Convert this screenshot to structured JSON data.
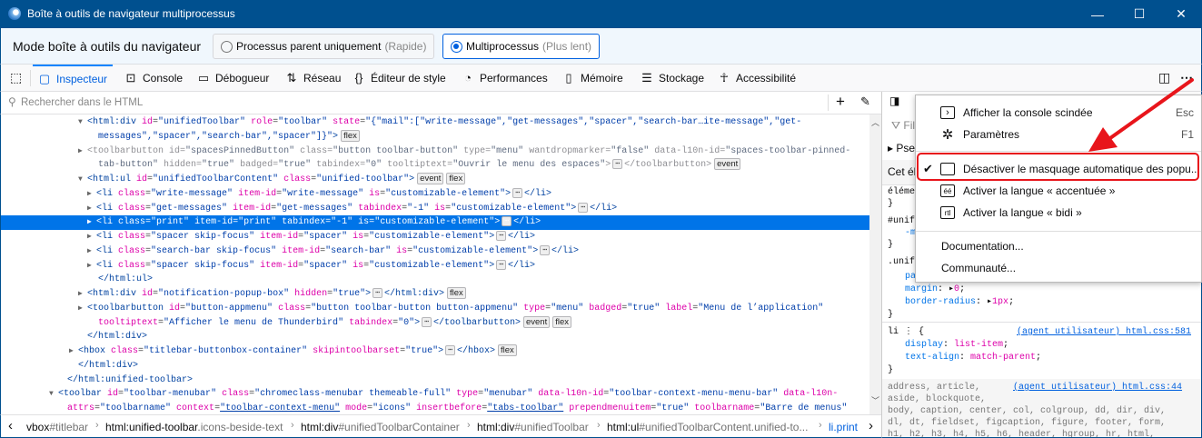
{
  "window": {
    "title": "Boîte à outils de navigateur multiprocessus",
    "minimize": "—",
    "maximize": "☐",
    "close": "✕"
  },
  "mode": {
    "label": "Mode boîte à outils du navigateur",
    "options": [
      {
        "label": "Processus parent uniquement",
        "hint": "(Rapide)",
        "selected": false
      },
      {
        "label": "Multiprocessus",
        "hint": "(Plus lent)",
        "selected": true
      }
    ]
  },
  "tabs": [
    {
      "label": "Inspecteur",
      "icon": "inspector-icon"
    },
    {
      "label": "Console",
      "icon": "console-icon"
    },
    {
      "label": "Débogueur",
      "icon": "debugger-icon"
    },
    {
      "label": "Réseau",
      "icon": "network-icon"
    },
    {
      "label": "Éditeur de style",
      "icon": "style-editor-icon"
    },
    {
      "label": "Performances",
      "icon": "performance-icon"
    },
    {
      "label": "Mémoire",
      "icon": "memory-icon"
    },
    {
      "label": "Stockage",
      "icon": "storage-icon"
    },
    {
      "label": "Accessibilité",
      "icon": "accessibility-icon"
    }
  ],
  "search": {
    "placeholder": "Rechercher dans le HTML"
  },
  "markup": [
    {
      "ind": 95,
      "arrow": "▼",
      "segs": [
        [
          "t",
          "<html:div "
        ],
        [
          "a",
          "id"
        ],
        [
          "p",
          "="
        ],
        [
          "v",
          "\"unifiedToolbar\" "
        ],
        [
          "a",
          "role"
        ],
        [
          "p",
          "="
        ],
        [
          "v",
          "\"toolbar\" "
        ],
        [
          "a",
          "state"
        ],
        [
          "p",
          "="
        ],
        [
          "v",
          "\"{\"mail\":[\"write-message\",\"get-messages\",\"spacer\",\"search-bar…ite-message\",\"get-"
        ]
      ]
    },
    {
      "ind": 107,
      "segs": [
        [
          "v",
          "messages\",\"spacer\",\"search-bar\",\"spacer\"]}\""
        ],
        [
          "t",
          ">"
        ],
        [
          "b",
          "flex"
        ]
      ]
    },
    {
      "ind": 95,
      "arrow": "▶",
      "dim": true,
      "segs": [
        [
          "t",
          "<toolbarbutton "
        ],
        [
          "a",
          "id"
        ],
        [
          "p",
          "="
        ],
        [
          "v",
          "\"spacesPinnedButton\" "
        ],
        [
          "a",
          "class"
        ],
        [
          "p",
          "="
        ],
        [
          "v",
          "\"button toolbar-button\" "
        ],
        [
          "a",
          "type"
        ],
        [
          "p",
          "="
        ],
        [
          "v",
          "\"menu\" "
        ],
        [
          "a",
          "wantdropmarker"
        ],
        [
          "p",
          "="
        ],
        [
          "v",
          "\"false\" "
        ],
        [
          "a",
          "data-l10n-id"
        ],
        [
          "p",
          "="
        ],
        [
          "v",
          "\"spaces-toolbar-pinned-"
        ]
      ]
    },
    {
      "ind": 107,
      "dim": true,
      "segs": [
        [
          "v",
          "tab-button\" "
        ],
        [
          "a",
          "hidden"
        ],
        [
          "p",
          "="
        ],
        [
          "v",
          "\"true\" "
        ],
        [
          "a",
          "badged"
        ],
        [
          "p",
          "="
        ],
        [
          "v",
          "\"true\" "
        ],
        [
          "a",
          "tabindex"
        ],
        [
          "p",
          "="
        ],
        [
          "v",
          "\"0\" "
        ],
        [
          "a",
          "tooltiptext"
        ],
        [
          "p",
          "="
        ],
        [
          "v",
          "\"Ouvrir le menu des espaces\""
        ],
        [
          "t",
          ">"
        ],
        [
          "e",
          "⋯"
        ],
        [
          "t",
          "</toolbarbutton>"
        ],
        [
          "b",
          "event"
        ]
      ]
    },
    {
      "ind": 95,
      "arrow": "▼",
      "segs": [
        [
          "t",
          "<html:ul "
        ],
        [
          "a",
          "id"
        ],
        [
          "p",
          "="
        ],
        [
          "v",
          "\"unifiedToolbarContent\" "
        ],
        [
          "a",
          "class"
        ],
        [
          "p",
          "="
        ],
        [
          "v",
          "\"unified-toolbar\""
        ],
        [
          "t",
          ">"
        ],
        [
          "b",
          "event"
        ],
        [
          "b",
          "flex"
        ]
      ]
    },
    {
      "ind": 105,
      "arrow": "▶",
      "segs": [
        [
          "t",
          "<li "
        ],
        [
          "a",
          "class"
        ],
        [
          "p",
          "="
        ],
        [
          "v",
          "\"write-message\" "
        ],
        [
          "a",
          "item-id"
        ],
        [
          "p",
          "="
        ],
        [
          "v",
          "\"write-message\" "
        ],
        [
          "a",
          "is"
        ],
        [
          "p",
          "="
        ],
        [
          "v",
          "\"customizable-element\""
        ],
        [
          "t",
          ">"
        ],
        [
          "e",
          "⋯"
        ],
        [
          "t",
          "</li>"
        ]
      ]
    },
    {
      "ind": 105,
      "arrow": "▶",
      "segs": [
        [
          "t",
          "<li "
        ],
        [
          "a",
          "class"
        ],
        [
          "p",
          "="
        ],
        [
          "v",
          "\"get-messages\" "
        ],
        [
          "a",
          "item-id"
        ],
        [
          "p",
          "="
        ],
        [
          "v",
          "\"get-messages\" "
        ],
        [
          "a",
          "tabindex"
        ],
        [
          "p",
          "="
        ],
        [
          "v",
          "\"-1\" "
        ],
        [
          "a",
          "is"
        ],
        [
          "p",
          "="
        ],
        [
          "v",
          "\"customizable-element\""
        ],
        [
          "t",
          ">"
        ],
        [
          "e",
          "⋯"
        ],
        [
          "t",
          "</li>"
        ]
      ]
    },
    {
      "ind": 105,
      "arrow": "▶",
      "sel": true,
      "segs": [
        [
          "t",
          "<li "
        ],
        [
          "a",
          "class"
        ],
        [
          "p",
          "="
        ],
        [
          "v",
          "\"print\" "
        ],
        [
          "a",
          "item-id"
        ],
        [
          "p",
          "="
        ],
        [
          "v",
          "\"print\" "
        ],
        [
          "a",
          "tabindex"
        ],
        [
          "p",
          "="
        ],
        [
          "v",
          "\"-1\" "
        ],
        [
          "a",
          "is"
        ],
        [
          "p",
          "="
        ],
        [
          "v",
          "\"customizable-element\""
        ],
        [
          "t",
          ">"
        ],
        [
          "e",
          "⋯"
        ],
        [
          "t",
          "</li>"
        ]
      ]
    },
    {
      "ind": 105,
      "arrow": "▶",
      "segs": [
        [
          "t",
          "<li "
        ],
        [
          "a",
          "class"
        ],
        [
          "p",
          "="
        ],
        [
          "v",
          "\"spacer skip-focus\" "
        ],
        [
          "a",
          "item-id"
        ],
        [
          "p",
          "="
        ],
        [
          "v",
          "\"spacer\" "
        ],
        [
          "a",
          "is"
        ],
        [
          "p",
          "="
        ],
        [
          "v",
          "\"customizable-element\""
        ],
        [
          "t",
          ">"
        ],
        [
          "e",
          "⋯"
        ],
        [
          "t",
          "</li>"
        ]
      ]
    },
    {
      "ind": 105,
      "arrow": "▶",
      "segs": [
        [
          "t",
          "<li "
        ],
        [
          "a",
          "class"
        ],
        [
          "p",
          "="
        ],
        [
          "v",
          "\"search-bar skip-focus\" "
        ],
        [
          "a",
          "item-id"
        ],
        [
          "p",
          "="
        ],
        [
          "v",
          "\"search-bar\" "
        ],
        [
          "a",
          "is"
        ],
        [
          "p",
          "="
        ],
        [
          "v",
          "\"customizable-element\""
        ],
        [
          "t",
          ">"
        ],
        [
          "e",
          "⋯"
        ],
        [
          "t",
          "</li>"
        ]
      ]
    },
    {
      "ind": 105,
      "arrow": "▶",
      "segs": [
        [
          "t",
          "<li "
        ],
        [
          "a",
          "class"
        ],
        [
          "p",
          "="
        ],
        [
          "v",
          "\"spacer skip-focus\" "
        ],
        [
          "a",
          "item-id"
        ],
        [
          "p",
          "="
        ],
        [
          "v",
          "\"spacer\" "
        ],
        [
          "a",
          "is"
        ],
        [
          "p",
          "="
        ],
        [
          "v",
          "\"customizable-element\""
        ],
        [
          "t",
          ">"
        ],
        [
          "e",
          "⋯"
        ],
        [
          "t",
          "</li>"
        ]
      ]
    },
    {
      "ind": 107,
      "segs": [
        [
          "t",
          "</html:ul>"
        ]
      ]
    },
    {
      "ind": 95,
      "arrow": "▶",
      "segs": [
        [
          "t",
          "<html:div "
        ],
        [
          "a",
          "id"
        ],
        [
          "p",
          "="
        ],
        [
          "v",
          "\"notification-popup-box\" "
        ],
        [
          "a",
          "hidden"
        ],
        [
          "p",
          "="
        ],
        [
          "v",
          "\"true\""
        ],
        [
          "t",
          ">"
        ],
        [
          "e",
          "⋯"
        ],
        [
          "t",
          "</html:div>"
        ],
        [
          "b",
          "flex"
        ]
      ]
    },
    {
      "ind": 95,
      "arrow": "▶",
      "segs": [
        [
          "t",
          "<toolbarbutton "
        ],
        [
          "a",
          "id"
        ],
        [
          "p",
          "="
        ],
        [
          "v",
          "\"button-appmenu\" "
        ],
        [
          "a",
          "class"
        ],
        [
          "p",
          "="
        ],
        [
          "v",
          "\"button toolbar-button button-appmenu\" "
        ],
        [
          "a",
          "type"
        ],
        [
          "p",
          "="
        ],
        [
          "v",
          "\"menu\" "
        ],
        [
          "a",
          "badged"
        ],
        [
          "p",
          "="
        ],
        [
          "v",
          "\"true\" "
        ],
        [
          "a",
          "label"
        ],
        [
          "p",
          "="
        ],
        [
          "v",
          "\"Menu de l’application\""
        ]
      ]
    },
    {
      "ind": 107,
      "segs": [
        [
          "a",
          "tooltiptext"
        ],
        [
          "p",
          "="
        ],
        [
          "v",
          "\"Afficher le menu de Thunderbird\" "
        ],
        [
          "a",
          "tabindex"
        ],
        [
          "p",
          "="
        ],
        [
          "v",
          "\"0\""
        ],
        [
          "t",
          ">"
        ],
        [
          "e",
          "⋯"
        ],
        [
          "t",
          "</toolbarbutton>"
        ],
        [
          "b",
          "event"
        ],
        [
          "b",
          "flex"
        ]
      ]
    },
    {
      "ind": 95,
      "segs": [
        [
          "t",
          "</html:div>"
        ]
      ]
    },
    {
      "ind": 85,
      "arrow": "▶",
      "segs": [
        [
          "t",
          "<hbox "
        ],
        [
          "a",
          "class"
        ],
        [
          "p",
          "="
        ],
        [
          "v",
          "\"titlebar-buttonbox-container\" "
        ],
        [
          "a",
          "skipintoolbarset"
        ],
        [
          "p",
          "="
        ],
        [
          "v",
          "\"true\""
        ],
        [
          "t",
          ">"
        ],
        [
          "e",
          "⋯"
        ],
        [
          "t",
          "</hbox>"
        ],
        [
          "b",
          "flex"
        ]
      ]
    },
    {
      "ind": 85,
      "segs": [
        [
          "t",
          "</html:div>"
        ]
      ]
    },
    {
      "ind": 73,
      "segs": [
        [
          "t",
          "</html:unified-toolbar>"
        ]
      ]
    },
    {
      "ind": 63,
      "arrow": "▼",
      "segs": [
        [
          "t",
          "<toolbar "
        ],
        [
          "a",
          "id"
        ],
        [
          "p",
          "="
        ],
        [
          "v",
          "\"toolbar-menubar\" "
        ],
        [
          "a",
          "class"
        ],
        [
          "p",
          "="
        ],
        [
          "v",
          "\"chromeclass-menubar themeable-full\" "
        ],
        [
          "a",
          "type"
        ],
        [
          "p",
          "="
        ],
        [
          "v",
          "\"menubar\" "
        ],
        [
          "a",
          "data-l10n-id"
        ],
        [
          "p",
          "="
        ],
        [
          "v",
          "\"toolbar-context-menu-menu-bar\" "
        ],
        [
          "a",
          "data-l10n-"
        ]
      ]
    },
    {
      "ind": 73,
      "segs": [
        [
          "a",
          "attrs"
        ],
        [
          "p",
          "="
        ],
        [
          "v",
          "\"toolbarname\" "
        ],
        [
          "a",
          "context"
        ],
        [
          "p",
          "="
        ],
        [
          "u",
          "\"toolbar-context-menu\""
        ],
        [
          "p",
          " "
        ],
        [
          "a",
          "mode"
        ],
        [
          "p",
          "="
        ],
        [
          "v",
          "\"icons\" "
        ],
        [
          "a",
          "insertbefore"
        ],
        [
          "p",
          "="
        ],
        [
          "u",
          "\"tabs-toolbar\""
        ],
        [
          "p",
          " "
        ],
        [
          "a",
          "prependmenuitem"
        ],
        [
          "p",
          "="
        ],
        [
          "v",
          "\"true\" "
        ],
        [
          "a",
          "toolbarname"
        ],
        [
          "p",
          "="
        ],
        [
          "v",
          "\"Barre de menus\""
        ]
      ]
    }
  ],
  "breadcrumbs": [
    {
      "tag": "vbox",
      "rest": "#titlebar"
    },
    {
      "tag": "html:unified-toolbar",
      "rest": ".icons-beside-text"
    },
    {
      "tag": "html:div",
      "rest": "#unifiedToolbarContainer"
    },
    {
      "tag": "html:div",
      "rest": "#unifiedToolbar"
    },
    {
      "tag": "html:ul",
      "rest": "#unifiedToolbarContent.unified-to..."
    },
    {
      "tag": "li.print",
      "rest": ""
    }
  ],
  "sidebar": {
    "filter": "Fil",
    "pseudo": "Pse",
    "this_element": "Cet él",
    "frag": [
      "éléme",
      "}",
      "#unif",
      "-m",
      "}",
      ".unif",
      "pa"
    ],
    "rule1": {
      "margin_prop": "margin",
      "margin_val": "0",
      "radius_prop": "border-radius",
      "radius_val": "1px"
    },
    "rule2": {
      "selector": "li",
      "source": "(agent utilisateur) html.css:581",
      "p1": "display",
      "v1": "list-item",
      "p2": "text-align",
      "v2": "match-parent"
    },
    "rule3": {
      "source": "(agent utilisateur) html.css:44",
      "lines": [
        "address, article,",
        "aside, blockquote,",
        "body, caption, center, col, colgroup, dd, dir, div,",
        "dl, dt, fieldset, figcaption, figure, footer, form,",
        "h1, h2, h3, h4, h5, h6, header, hgroup, hr, html,"
      ]
    }
  },
  "menu": {
    "items": [
      {
        "label": "Afficher la console scindée",
        "key": "Esc",
        "icon": "console-icon"
      },
      {
        "label": "Paramètres",
        "key": "F1",
        "icon": "gear-icon"
      },
      {
        "label": "Désactiver le masquage automatique des popu...",
        "checked": true,
        "icon": "popup-icon"
      },
      {
        "label": "Activer la langue « accentuée »",
        "icon": "accented-locale-icon"
      },
      {
        "label": "Activer la langue « bidi »",
        "icon": "rtl-locale-icon"
      },
      {
        "label": "Documentation..."
      },
      {
        "label": "Communauté..."
      }
    ]
  },
  "colors": {
    "titlebar": "#00508f",
    "accent": "#0060df",
    "selection": "#0074e8",
    "highlight": "#e8151b"
  }
}
